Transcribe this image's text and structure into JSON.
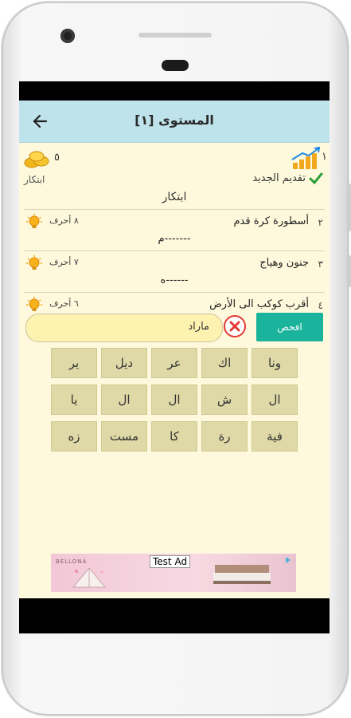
{
  "header": {
    "title": "المستوى [١]"
  },
  "level": {
    "number": "١"
  },
  "coins": {
    "count": "٥"
  },
  "mode": {
    "label": "ابتكار"
  },
  "submitted": {
    "label": "تقديم الجديد"
  },
  "answer": {
    "text": "ابتكار"
  },
  "rows": [
    {
      "num": "٢",
      "clue": "أسطورة كرة قدم",
      "letters": "٨ أحرف",
      "pattern": "م-------"
    },
    {
      "num": "٣",
      "clue": "جنون وهياج",
      "letters": "٧ أحرف",
      "pattern": "ه------"
    },
    {
      "num": "٤",
      "clue": "أقرب كوكب الى الأرض",
      "letters": "٦ أحرف",
      "pattern": ""
    }
  ],
  "input": {
    "value": "ماراد"
  },
  "check_button": {
    "label": "افحص"
  },
  "tiles": [
    [
      "ونا",
      "اك",
      "عر",
      "ديل",
      "ير"
    ],
    [
      "ال",
      "ش",
      "ال",
      "ال",
      "يا"
    ],
    [
      "فية",
      "رة",
      "كا",
      "مست",
      "زه"
    ]
  ],
  "ad": {
    "label": "Test Ad",
    "brand": "BELLONA"
  },
  "colors": {
    "appbar": "#bfe3ea",
    "background": "#fef9dc",
    "accent": "#1ab39c",
    "tile": "#ded9a6"
  }
}
